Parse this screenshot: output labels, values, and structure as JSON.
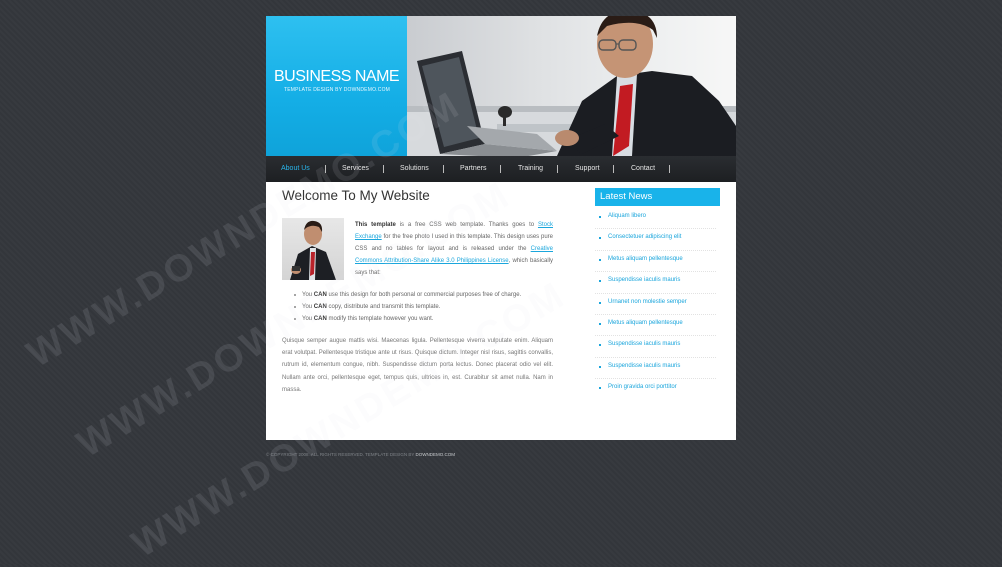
{
  "header": {
    "brand_name": "BUSINESS NAME",
    "brand_subtitle": "TEMPLATE DESIGN BY DOWNDEMO.COM",
    "brand_color": "#19b3ea"
  },
  "nav": {
    "items": [
      {
        "label": "About Us",
        "active": true
      },
      {
        "label": "Services"
      },
      {
        "label": "Solutions"
      },
      {
        "label": "Partners"
      },
      {
        "label": "Training"
      },
      {
        "label": "Support"
      },
      {
        "label": "Contact"
      }
    ],
    "separator": "|"
  },
  "main": {
    "title": "Welcome To My Website",
    "intro": {
      "p1": "This template",
      "p2": " is a free CSS web template. Thanks goes to ",
      "link1": "Stock Exchange",
      "p3": " for the free photo I used in this template. This design uses pure CSS and no tables for layout and is released under the ",
      "link2": "Creative Commons Attribution-Share Alike 3.0 Philippines License",
      "p4": ", which basically says that:"
    },
    "bullets": [
      {
        "pre": "You ",
        "strong": "CAN",
        "post": " use this design for both personal or commercial purposes free of charge."
      },
      {
        "pre": "You ",
        "strong": "CAN",
        "post": " copy, distribute and transmit this template."
      },
      {
        "pre": "You ",
        "strong": "CAN",
        "post": " modify this template however you want."
      }
    ],
    "paragraph": "Quisque semper augue mattis wisi. Maecenas ligula. Pellentesque viverra vulputate enim. Aliquam erat volutpat. Pellentesque tristique ante ut risus. Quisque dictum. Integer nisl risus, sagittis convallis, rutrum id, elementum congue, nibh. Suspendisse dictum porta lectus. Donec placerat odio vel elit. Nullam ante orci, pellentesque eget, tempus quis, ultrices in, est. Curabitur sit amet nulla. Nam in massa."
  },
  "sidebar": {
    "heading": "Latest News",
    "items": [
      "Aliquam libero",
      "Consectetuer adipiscing elit",
      "Metus aliquam pellentesque",
      "Suspendisse iaculis mauris",
      "Urnanet non molestie semper",
      "Metus aliquam pellentesque",
      "Suspendisse iaculis mauris",
      "Suspendisse iaculis mauris",
      "Proin gravida orci porttitor"
    ]
  },
  "footer": {
    "text": "© COPYRIGHT 2008. ALL RIGHTS RESERVED. TEMPLATE DESIGN BY ",
    "link": "DOWNDEMO.COM"
  },
  "watermark": {
    "text": "WWW.DOWNDEMO.COM"
  }
}
